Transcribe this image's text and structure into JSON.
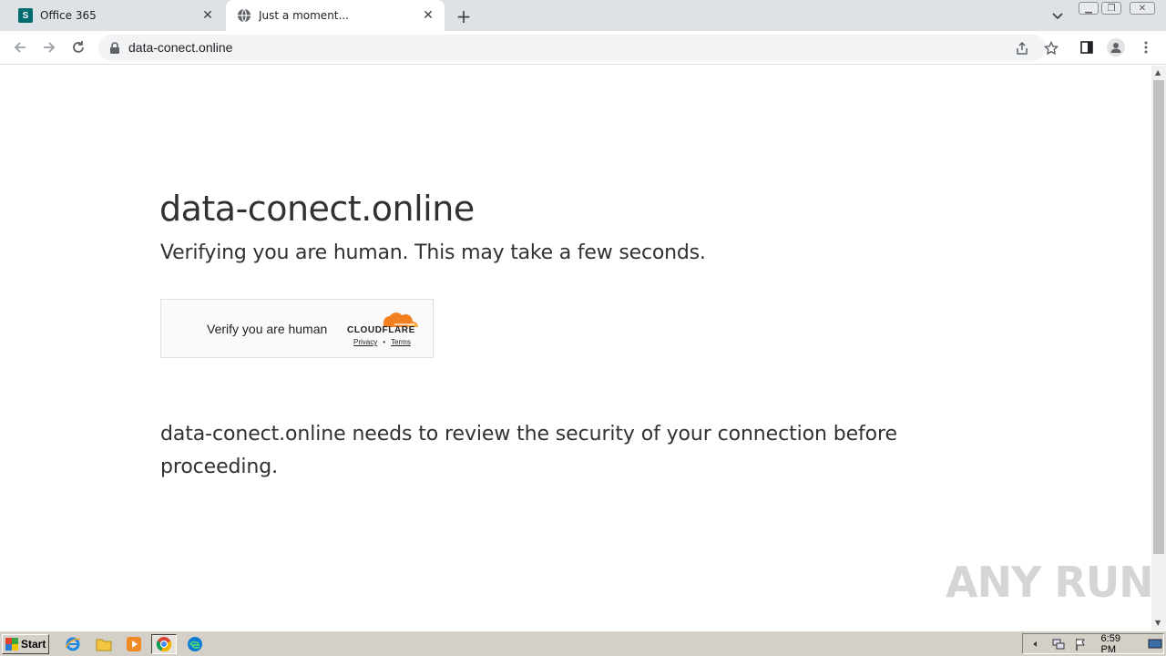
{
  "browser": {
    "tabs": [
      {
        "title": "Office 365",
        "favicon": "sharepoint-icon",
        "active": false
      },
      {
        "title": "Just a moment...",
        "favicon": "globe-icon",
        "active": true
      }
    ],
    "address_bar": {
      "url": "data-conect.online"
    }
  },
  "page": {
    "heading": "data-conect.online",
    "subheading": "Verifying you are human. This may take a few seconds.",
    "challenge": {
      "label": "Verify you are human",
      "brand": "CLOUDFLARE",
      "privacy_link": "Privacy",
      "separator": "•",
      "terms_link": "Terms"
    },
    "review_text": "data-conect.online needs to review the security of your connection before proceeding."
  },
  "watermark": "ANY RUN",
  "taskbar": {
    "start_label": "Start",
    "clock": "6:59 PM"
  },
  "colors": {
    "cloudflare_orange": "#f38020",
    "cloudflare_light": "#fbad41",
    "text": "#313131"
  }
}
